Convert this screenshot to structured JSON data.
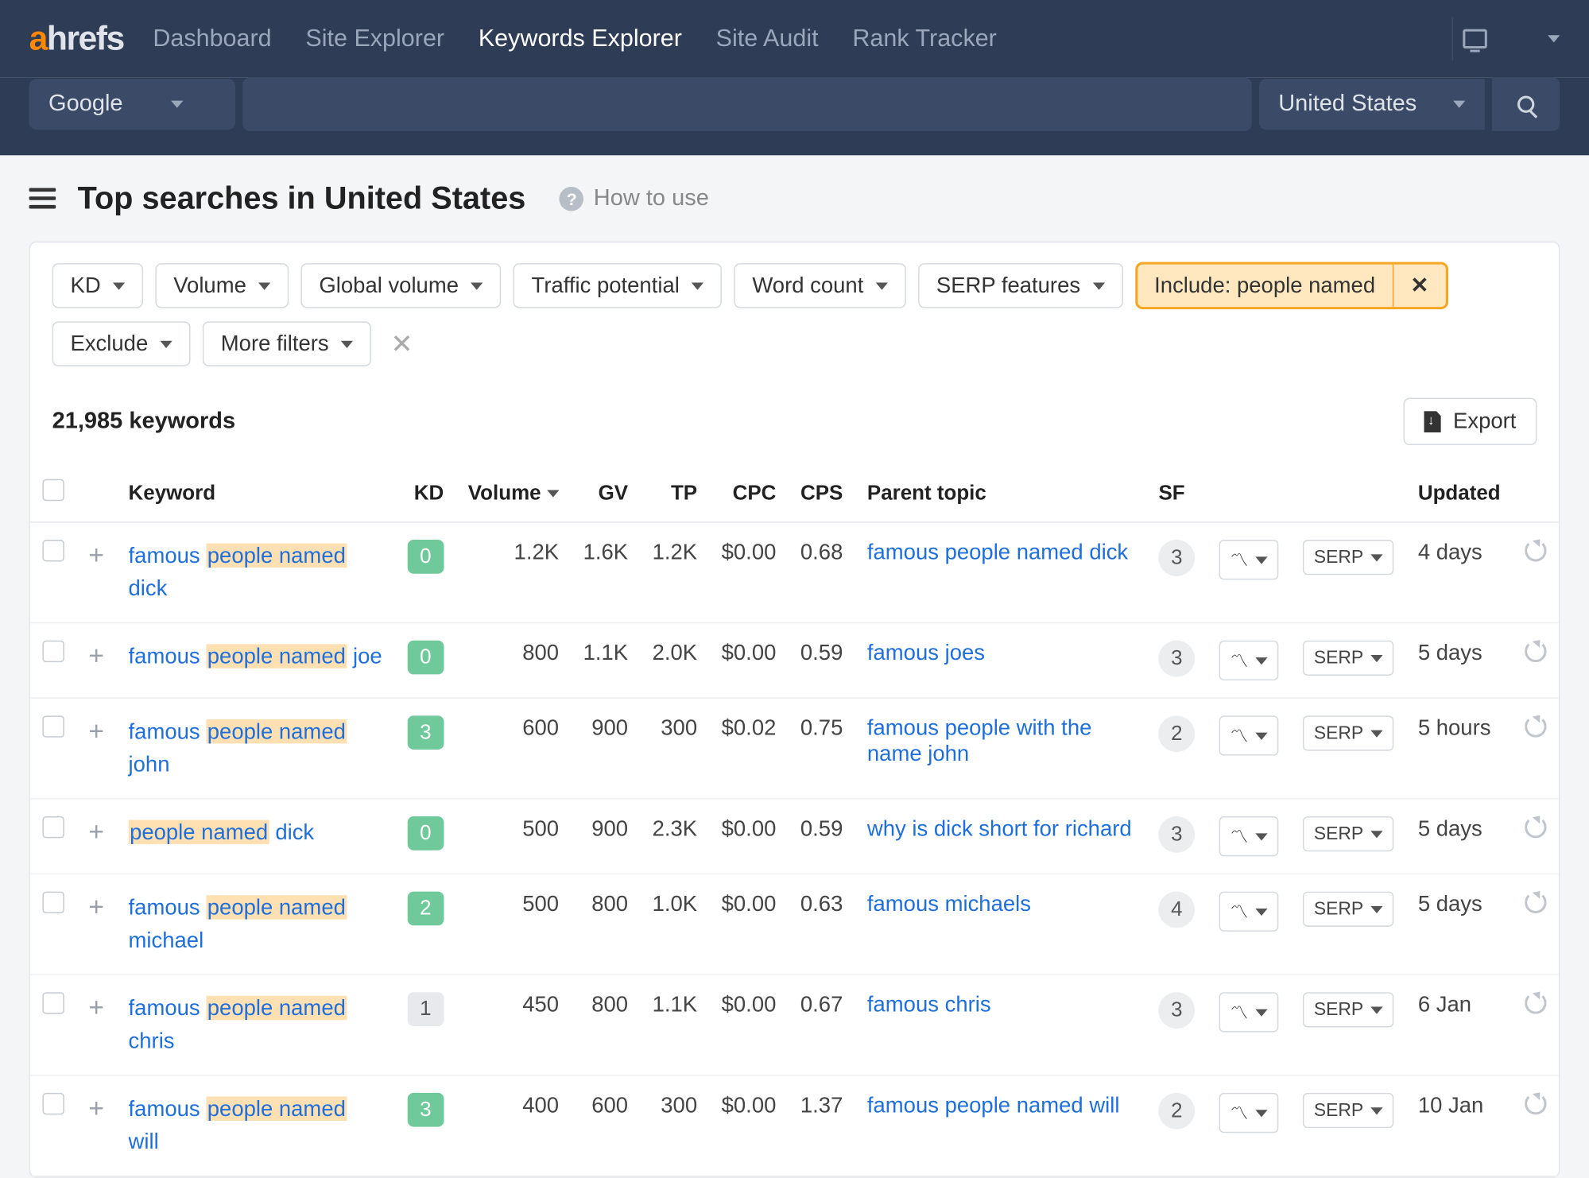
{
  "brand": {
    "part1": "a",
    "part2": "hrefs"
  },
  "nav": {
    "items": [
      "Dashboard",
      "Site Explorer",
      "Keywords Explorer",
      "Site Audit",
      "Rank Tracker"
    ],
    "active_index": 2
  },
  "search": {
    "engine": "Google",
    "country": "United States"
  },
  "page": {
    "title": "Top searches in United States",
    "how_to_use": "How to use"
  },
  "filters": {
    "list": [
      "KD",
      "Volume",
      "Global volume",
      "Traffic potential",
      "Word count",
      "SERP features"
    ],
    "include": {
      "label": "Include: people named"
    },
    "second_row": [
      "Exclude",
      "More filters"
    ]
  },
  "results": {
    "count_label": "21,985 keywords",
    "export_label": "Export"
  },
  "columns": {
    "keyword": "Keyword",
    "kd": "KD",
    "volume": "Volume",
    "gv": "GV",
    "tp": "TP",
    "cpc": "CPC",
    "cps": "CPS",
    "parent": "Parent topic",
    "sf": "SF",
    "serp_btn": "SERP",
    "updated": "Updated"
  },
  "highlight_phrase": "people named",
  "rows": [
    {
      "keyword": "famous people named dick",
      "kd": "0",
      "kd_class": "kd-green",
      "volume": "1.2K",
      "gv": "1.6K",
      "tp": "1.2K",
      "cpc": "$0.00",
      "cps": "0.68",
      "parent": "famous people named dick",
      "sf": "3",
      "updated": "4 days"
    },
    {
      "keyword": "famous people named joe",
      "kd": "0",
      "kd_class": "kd-green",
      "volume": "800",
      "gv": "1.1K",
      "tp": "2.0K",
      "cpc": "$0.00",
      "cps": "0.59",
      "parent": "famous joes",
      "sf": "3",
      "updated": "5 days"
    },
    {
      "keyword": "famous people named john",
      "kd": "3",
      "kd_class": "kd-green",
      "volume": "600",
      "gv": "900",
      "tp": "300",
      "cpc": "$0.02",
      "cps": "0.75",
      "parent": "famous people with the name john",
      "sf": "2",
      "updated": "5 hours"
    },
    {
      "keyword": "people named dick",
      "kd": "0",
      "kd_class": "kd-green",
      "volume": "500",
      "gv": "900",
      "tp": "2.3K",
      "cpc": "$0.00",
      "cps": "0.59",
      "parent": "why is dick short for richard",
      "sf": "3",
      "updated": "5 days"
    },
    {
      "keyword": "famous people named michael",
      "kd": "2",
      "kd_class": "kd-green",
      "volume": "500",
      "gv": "800",
      "tp": "1.0K",
      "cpc": "$0.00",
      "cps": "0.63",
      "parent": "famous michaels",
      "sf": "4",
      "updated": "5 days"
    },
    {
      "keyword": "famous people named chris",
      "kd": "1",
      "kd_class": "kd-gray",
      "volume": "450",
      "gv": "800",
      "tp": "1.1K",
      "cpc": "$0.00",
      "cps": "0.67",
      "parent": "famous chris",
      "sf": "3",
      "updated": "6 Jan"
    },
    {
      "keyword": "famous people named will",
      "kd": "3",
      "kd_class": "kd-green",
      "volume": "400",
      "gv": "600",
      "tp": "300",
      "cpc": "$0.00",
      "cps": "1.37",
      "parent": "famous people named will",
      "sf": "2",
      "updated": "10 Jan"
    }
  ]
}
